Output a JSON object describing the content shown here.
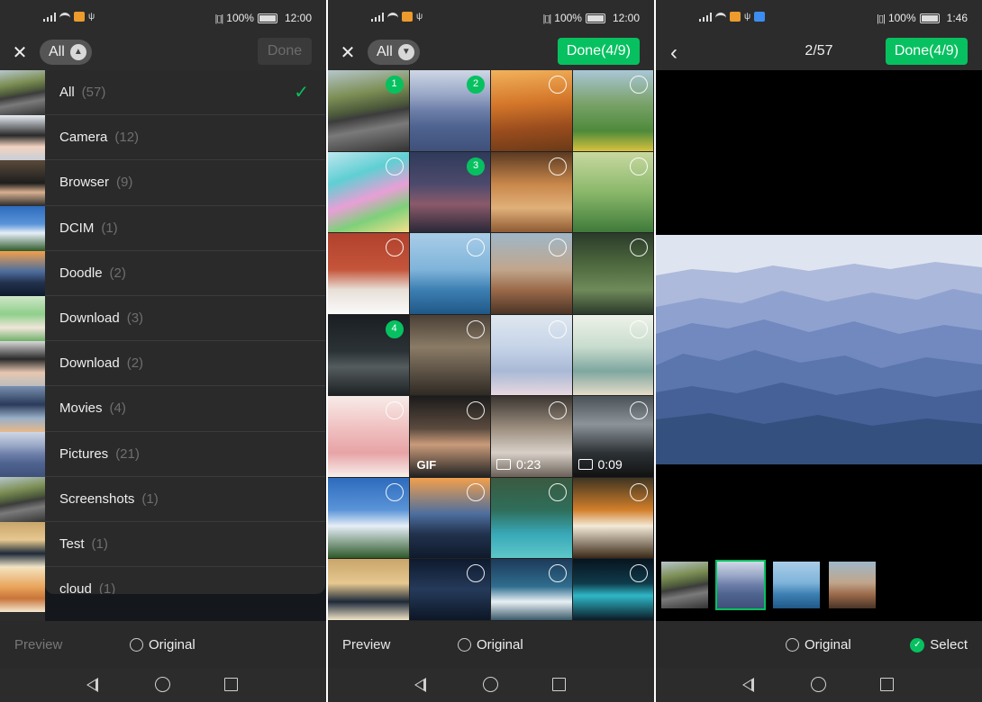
{
  "status_bars": [
    {
      "time": "12:00",
      "battery": "100%"
    },
    {
      "time": "12:00",
      "battery": "100%"
    },
    {
      "time": "1:46",
      "battery": "100%"
    }
  ],
  "panel1": {
    "album_label": "All",
    "done_label": "Done",
    "albums": [
      {
        "name": "All",
        "count": "(57)",
        "selected": true
      },
      {
        "name": "Camera",
        "count": "(12)"
      },
      {
        "name": "Browser",
        "count": "(9)"
      },
      {
        "name": "DCIM",
        "count": "(1)"
      },
      {
        "name": "Doodle",
        "count": "(2)"
      },
      {
        "name": "Download",
        "count": "(3)"
      },
      {
        "name": "Download",
        "count": "(2)"
      },
      {
        "name": "Movies",
        "count": "(4)"
      },
      {
        "name": "Pictures",
        "count": "(21)"
      },
      {
        "name": "Screenshots",
        "count": "(1)"
      },
      {
        "name": "Test",
        "count": "(1)"
      },
      {
        "name": "cloud",
        "count": "(1)"
      }
    ],
    "preview_label": "Preview",
    "original_label": "Original"
  },
  "panel2": {
    "album_label": "All",
    "done_label": "Done(4/9)",
    "badges": {
      "b1": "1",
      "b2": "2",
      "b3": "3",
      "b4": "4"
    },
    "video1_duration": "0:23",
    "video2_duration": "0:09",
    "gif_label": "GIF",
    "preview_label": "Preview",
    "original_label": "Original"
  },
  "panel3": {
    "counter": "2/57",
    "done_label": "Done(4/9)",
    "original_label": "Original",
    "select_label": "Select"
  },
  "colors": {
    "accent": "#07c160",
    "background": "#2c2c2c"
  }
}
